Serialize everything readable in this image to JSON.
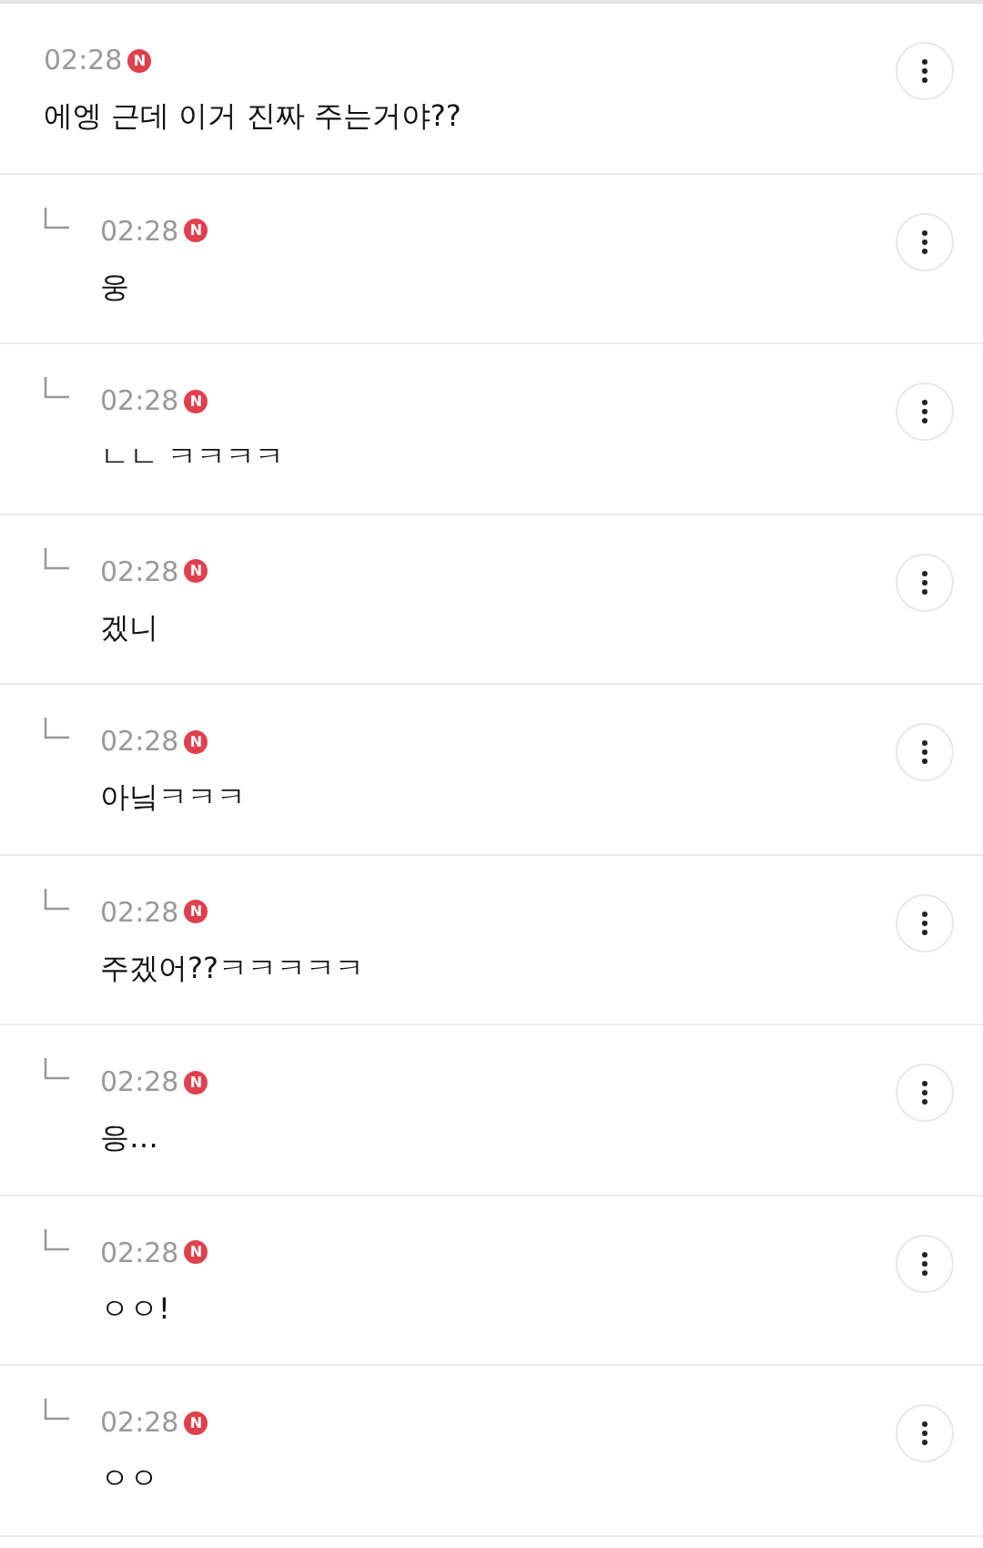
{
  "comment": {
    "time": "02:28",
    "badge": "N",
    "text": "에엥 근데 이거 진짜 주는거야??",
    "children": [
      {
        "time": "02:28",
        "badge": "N",
        "text": "웅"
      },
      {
        "time": "02:28",
        "badge": "N",
        "text": "ㄴㄴ ㅋㅋㅋㅋ"
      },
      {
        "time": "02:28",
        "badge": "N",
        "text": "겠니"
      },
      {
        "time": "02:28",
        "badge": "N",
        "text": "아닠ㅋㅋㅋ"
      },
      {
        "time": "02:28",
        "badge": "N",
        "text": "주겠어??ㅋㅋㅋㅋㅋ"
      },
      {
        "time": "02:28",
        "badge": "N",
        "text": "응…"
      },
      {
        "time": "02:28",
        "badge": "N",
        "text": "ㅇㅇ!"
      },
      {
        "time": "02:28",
        "badge": "N",
        "text": "ㅇㅇ"
      }
    ]
  }
}
